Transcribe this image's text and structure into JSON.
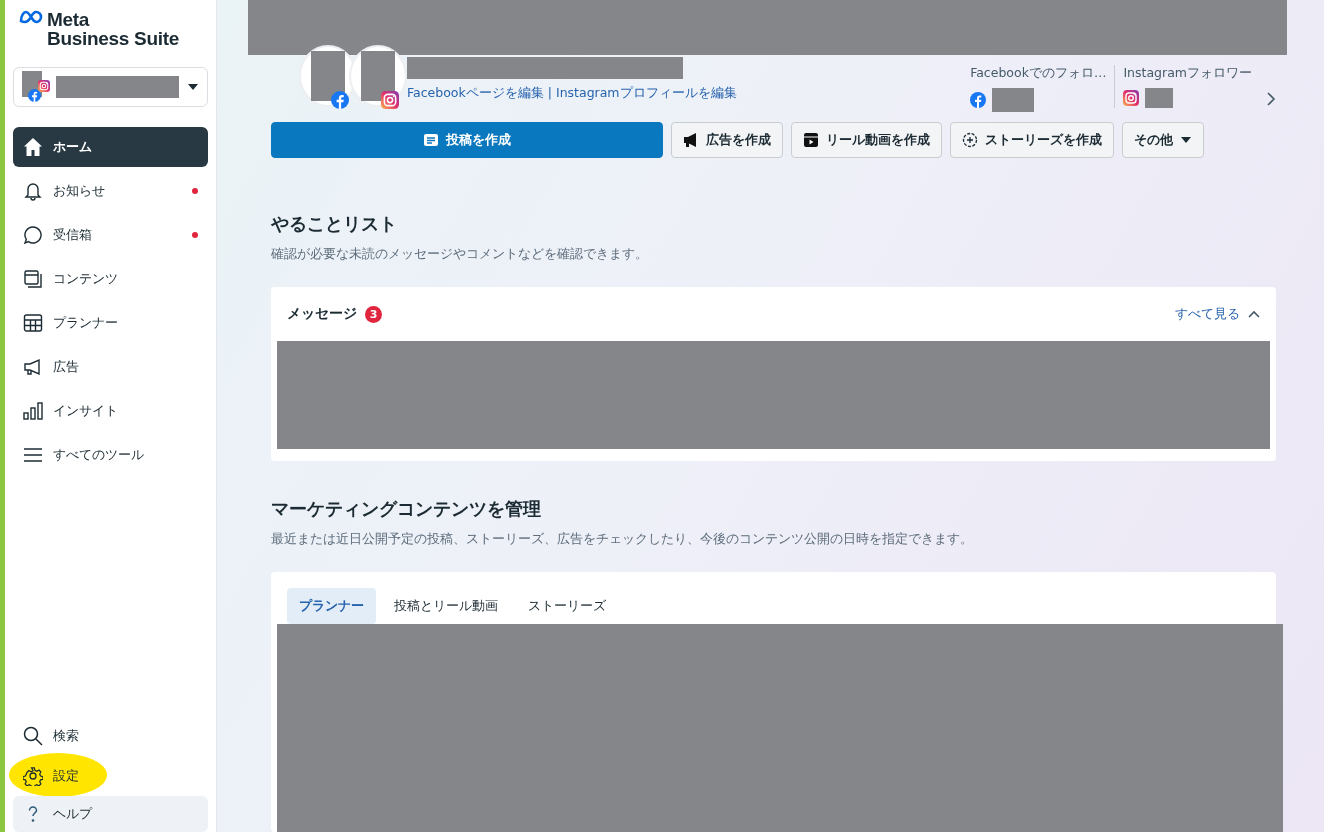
{
  "sidebar": {
    "logo": {
      "line1": "Meta",
      "line2": "Business Suite"
    },
    "nav_items": [
      {
        "label": "ホーム",
        "kind": "home",
        "selected": true,
        "unread": false
      },
      {
        "label": "お知らせ",
        "kind": "bell",
        "selected": false,
        "unread": true
      },
      {
        "label": "受信箱",
        "kind": "chat",
        "selected": false,
        "unread": true
      },
      {
        "label": "コンテンツ",
        "kind": "content",
        "selected": false,
        "unread": false
      },
      {
        "label": "プランナー",
        "kind": "calendar",
        "selected": false,
        "unread": false
      },
      {
        "label": "広告",
        "kind": "megaphone",
        "selected": false,
        "unread": false
      },
      {
        "label": "インサイト",
        "kind": "bars",
        "selected": false,
        "unread": false
      },
      {
        "label": "すべてのツール",
        "kind": "menu",
        "selected": false,
        "unread": false
      }
    ],
    "bottom_items": [
      {
        "label": "検索",
        "kind": "search",
        "hovered": false,
        "highlighted": false
      },
      {
        "label": "設定",
        "kind": "settings",
        "hovered": false,
        "highlighted": true
      },
      {
        "label": "ヘルプ",
        "kind": "help",
        "hovered": true,
        "highlighted": false
      }
    ]
  },
  "profile": {
    "edit_links": [
      {
        "label": "Facebookページを編集"
      },
      {
        "label": "Instagramプロフィールを編集"
      }
    ],
    "separator": "|",
    "stats": [
      {
        "label": "Facebookでのフォロ…",
        "kind": "facebook"
      },
      {
        "label": "Instagramフォロワー",
        "kind": "instagram"
      }
    ]
  },
  "actions": [
    {
      "label": "投稿を作成",
      "kind": "post",
      "primary": true
    },
    {
      "label": "広告を作成",
      "kind": "megaphone",
      "primary": false
    },
    {
      "label": "リール動画を作成",
      "kind": "reel",
      "primary": false
    },
    {
      "label": "ストーリーズを作成",
      "kind": "story",
      "primary": false
    },
    {
      "label": "その他",
      "kind": "caret",
      "primary": false
    }
  ],
  "todo": {
    "title": "やることリスト",
    "subtitle": "確認が必要な未読のメッセージやコメントなどを確認できます。",
    "card": {
      "title": "メッセージ",
      "badge": "3",
      "link": "すべて見る",
      "expanded": true
    }
  },
  "marketing": {
    "title": "マーケティングコンテンツを管理",
    "subtitle": "最近または近日公開予定の投稿、ストーリーズ、広告をチェックしたり、今後のコンテンツ公開の日時を指定できます。",
    "tabs": [
      {
        "label": "プランナー",
        "selected": true
      },
      {
        "label": "投稿とリール動画",
        "selected": false
      },
      {
        "label": "ストーリーズ",
        "selected": false
      }
    ]
  }
}
